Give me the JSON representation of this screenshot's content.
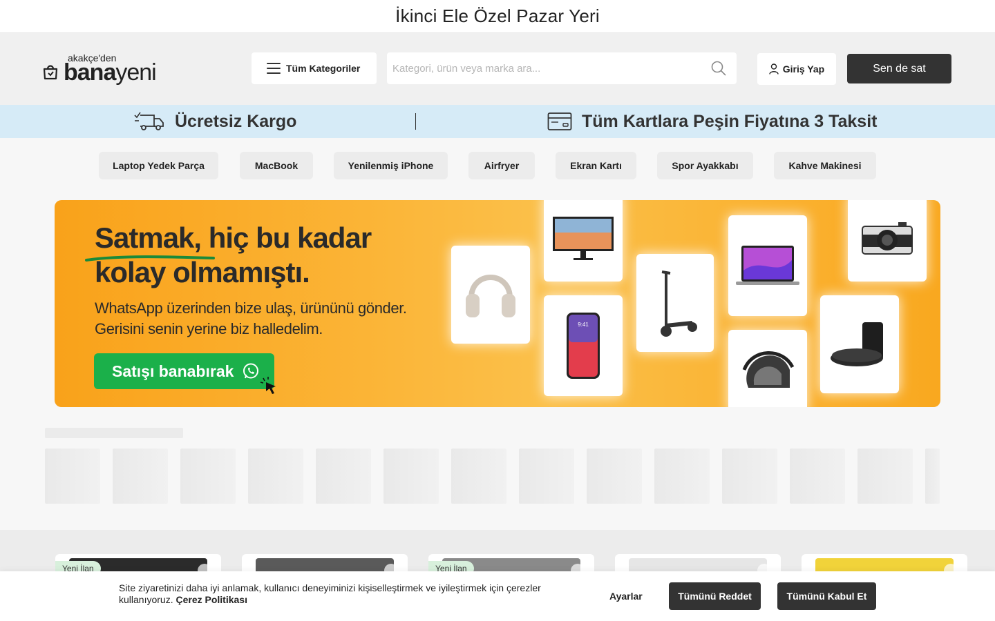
{
  "page_title": "İkinci Ele Özel Pazar Yeri",
  "logo": {
    "small_text": "akakçe'den",
    "brand_bold": "bana",
    "brand_light": "yeni"
  },
  "header": {
    "categories_label": "Tüm Kategoriler",
    "search_placeholder": "Kategori, ürün veya marka ara...",
    "login_label": "Giriş Yap",
    "sell_label": "Sen de sat"
  },
  "promo": {
    "shipping": "Ücretsiz Kargo",
    "installment": "Tüm Kartlara Peşin Fiyatına 3 Taksit"
  },
  "chips": [
    "Laptop Yedek Parça",
    "MacBook",
    "Yenilenmiş iPhone",
    "Airfryer",
    "Ekran Kartı",
    "Spor Ayakkabı",
    "Kahve Makinesi"
  ],
  "banner": {
    "headline_1": "Satmak, hiç bu kadar",
    "headline_2": "kolay olmamıştı.",
    "sub_1": "WhatsApp üzerinden bize ulaş, ürününü gönder.",
    "sub_2": "Gerisini senin yerine biz halledelim.",
    "cta": "Satışı banabırak",
    "phone_time": "9:41"
  },
  "listings": [
    {
      "badge": "Yeni İlan"
    },
    {
      "badge": ""
    },
    {
      "badge": "Yeni İlan"
    },
    {
      "badge": ""
    },
    {
      "badge": ""
    }
  ],
  "cookie": {
    "text": "Site ziyaretinizi daha iyi anlamak, kullanıcı deneyiminizi kişiselleştirmek ve iyileştirmek için çerezler kullanıyoruz.",
    "policy_link": "Çerez Politikası",
    "settings": "Ayarlar",
    "reject_all": "Tümünü Reddet",
    "accept_all": "Tümünü Kabul Et"
  },
  "colors": {
    "accent_dark": "#333333",
    "promo_bg": "#d6ebf7",
    "banner_orange": "#f9a21a",
    "whatsapp_green": "#1bb04a",
    "new_badge": "#d8f0dc"
  }
}
